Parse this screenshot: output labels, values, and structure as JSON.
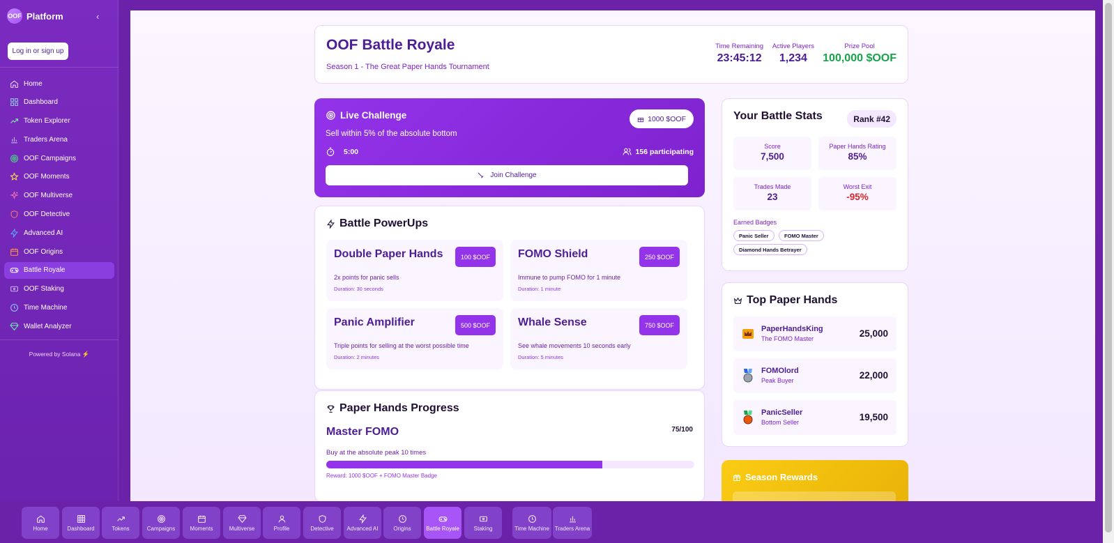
{
  "sidebar": {
    "brand": {
      "logo": "OOF",
      "name": "Platform"
    },
    "collapse_icon": "chevron-left-icon",
    "login_label": "Log in or sign up",
    "items": [
      {
        "label": "Home",
        "icon": "home-icon"
      },
      {
        "label": "Dashboard",
        "icon": "grid-icon"
      },
      {
        "label": "Token Explorer",
        "icon": "trending-icon"
      },
      {
        "label": "Traders Arena",
        "icon": "bar-chart-icon"
      },
      {
        "label": "OOF Campaigns",
        "icon": "target-icon"
      },
      {
        "label": "OOF Moments",
        "icon": "star-icon"
      },
      {
        "label": "OOF Multiverse",
        "icon": "sparkles-icon"
      },
      {
        "label": "OOF Detective",
        "icon": "shield-icon"
      },
      {
        "label": "Advanced AI",
        "icon": "zap-icon"
      },
      {
        "label": "OOF Origins",
        "icon": "calendar-icon"
      },
      {
        "label": "Battle Royale",
        "icon": "gamepad-icon",
        "active": true
      },
      {
        "label": "OOF Staking",
        "icon": "card-icon"
      },
      {
        "label": "Time Machine",
        "icon": "clock-icon"
      },
      {
        "label": "Wallet Analyzer",
        "icon": "gem-icon"
      }
    ],
    "powered_by": "Powered by Solana ⚡"
  },
  "header": {
    "title": "OOF Battle Royale",
    "subtitle": "Season 1 - The Great Paper Hands Tournament",
    "stats": [
      {
        "label": "Time Remaining",
        "value": "23:45:12"
      },
      {
        "label": "Active Players",
        "value": "1,234"
      },
      {
        "label": "Prize Pool",
        "value": "100,000 $OOF",
        "color": "#16a34a"
      }
    ]
  },
  "live_challenge": {
    "title": "Live Challenge",
    "description": "Sell within 5% of the absolute bottom",
    "prize": "1000 $OOF",
    "timer": "5:00",
    "participating": "156 participating",
    "join_label": "Join Challenge"
  },
  "powerups": {
    "title": "Battle PowerUps",
    "items": [
      {
        "name": "Double Paper Hands",
        "cost": "100 $OOF",
        "description": "2x points for panic sells",
        "duration": "Duration: 30 seconds"
      },
      {
        "name": "FOMO Shield",
        "cost": "250 $OOF",
        "description": "Immune to pump FOMO for 1 minute",
        "duration": "Duration: 1 minute"
      },
      {
        "name": "Panic Amplifier",
        "cost": "500 $OOF",
        "description": "Triple points for selling at the worst possible time",
        "duration": "Duration: 2 minutes"
      },
      {
        "name": "Whale Sense",
        "cost": "750 $OOF",
        "description": "See whale movements 10 seconds early",
        "duration": "Duration: 5 minutes"
      }
    ]
  },
  "progress": {
    "title": "Paper Hands Progress",
    "milestone": "Master FOMO",
    "count": "75/100",
    "current": 75,
    "target": 100,
    "description": "Buy at the absolute peak 10 times",
    "reward": "Reward: 1000 $OOF + FOMO Master Badge"
  },
  "battle_stats": {
    "title": "Your Battle Stats",
    "rank": "Rank #42",
    "stats": [
      {
        "label": "Score",
        "value": "7,500"
      },
      {
        "label": "Paper Hands Rating",
        "value": "85%"
      },
      {
        "label": "Trades Made",
        "value": "23"
      },
      {
        "label": "Worst Exit",
        "value": "-95%",
        "color": "#dc2626"
      }
    ],
    "badges_label": "Earned Badges",
    "badges": [
      "Panic Seller",
      "FOMO Master",
      "Diamond Hands Betrayer"
    ]
  },
  "top_paper_hands": {
    "title": "Top Paper Hands",
    "entries": [
      {
        "name": "PaperHandsKing",
        "subtitle": "The FOMO Master",
        "score": "25,000",
        "icon": "crown-medal-icon"
      },
      {
        "name": "FOMOlord",
        "subtitle": "Peak Buyer",
        "score": "22,000",
        "icon": "silver-medal-icon"
      },
      {
        "name": "PanicSeller",
        "subtitle": "Bottom Seller",
        "score": "19,500",
        "icon": "bronze-medal-icon"
      }
    ]
  },
  "season_rewards": {
    "title": "Season Rewards"
  },
  "bottom_nav": [
    {
      "label": "Home",
      "icon": "home-icon"
    },
    {
      "label": "Dashboard",
      "icon": "grid-icon"
    },
    {
      "label": "Tokens",
      "icon": "trending-icon"
    },
    {
      "label": "Campaigns",
      "icon": "target-icon"
    },
    {
      "label": "Moments",
      "icon": "calendar-icon"
    },
    {
      "label": "Multiverse",
      "icon": "gem-icon"
    },
    {
      "label": "Profile",
      "icon": "user-icon"
    },
    {
      "label": "Detective",
      "icon": "shield-icon"
    },
    {
      "label": "Advanced AI",
      "icon": "zap-icon"
    },
    {
      "label": "Origins",
      "icon": "clock-icon"
    },
    {
      "label": "Battle Royale",
      "icon": "gamepad-icon",
      "active": true
    },
    {
      "label": "Staking",
      "icon": "card-icon"
    },
    {
      "label": "Time Machine",
      "icon": "clock-icon"
    },
    {
      "label": "Traders Arena",
      "icon": "bar-chart-icon"
    }
  ],
  "colors": {
    "accent": "#9333ea",
    "brand_dark": "#6b21a8",
    "positive": "#16a34a",
    "negative": "#dc2626",
    "gold": "#eab308"
  }
}
